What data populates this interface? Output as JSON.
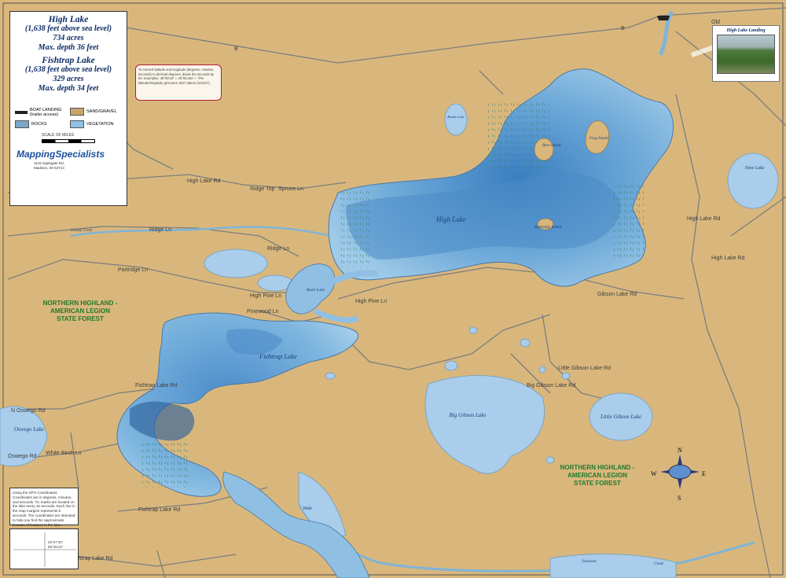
{
  "legend": {
    "high_name": "High Lake",
    "high_elev": "(1,638 feet above sea level)",
    "high_acres": "734 acres",
    "high_depth": "Max. depth 36 feet",
    "fish_name": "Fishtrap Lake",
    "fish_elev": "(1,638 feet above sea level)",
    "fish_acres": "329 acres",
    "fish_depth": "Max. depth 34 feet",
    "key_boat": "BOAT LANDING",
    "key_boat_sub": "(trailer access)",
    "key_sand": "SAND/GRAVEL",
    "key_rocks": "ROCKS",
    "key_veg": "VEGETATION",
    "scale": "SCALE OF MILES",
    "brand": "MappingSpecialists",
    "addr": [
      "1116 Applegate Rd.",
      "Madison, WI 53713"
    ]
  },
  "convert_box": "To convert latitude and longitude (degrees, minutes, seconds) to decimal degrees, divide the seconds by 60. Examples: 46°06'15\" = 46°06.250 — The latitude/longitude grid uses 1927 datum (NAD27).",
  "gps_box": "Using the GPS Coordinates. Coordinates are in degrees, minutes, and seconds. Tic marks are located on the lake every 15 seconds. Each line in the map margins represents 5 seconds. The coordinates are intended to help you find the approximate location of features in the lake.",
  "coord_box": {
    "lat": "46°07'40\"",
    "lon": "89°36'10\""
  },
  "landing_caption": "High Lake Landing",
  "lakes": {
    "high": "High Lake",
    "fishtrap": "Fishtrap Lake",
    "bear_island": "Bear Island",
    "frog_island": "Frog Island",
    "battleship_island": "Battleship Island",
    "rush": "Rush Lake",
    "oswego": "Oswego Lake",
    "big_gibson": "Big Gibson Lake",
    "little_gibson": "Little Gibson Lake",
    "sime": "Sime Lake",
    "hands": "Hands Lake",
    "wide": "Wide",
    "johnson": "Johnson",
    "grassy_creek": "Grassy Creek",
    "creek": "Creek"
  },
  "roads": {
    "b1": "B",
    "b2": "B",
    "high_lake_rd": "High Lake Rd",
    "ridge_top": "Ridge Top",
    "spruce": "Spruce Ln",
    "ridge_ln": "Ridge Ln",
    "ridge_ln2": "Ridge Ln",
    "partridge": "Partridge Ln",
    "high_pine": "High Pine Ln",
    "high_pine2": "High Pine Ln",
    "pinewood": "Pinewood Ln",
    "fishtrap_lake_rd": "Fishtrap Lake Rd",
    "n_oswego": "N Oswego Rd",
    "oswego_rd": "Oswego Rd",
    "white_birch": "White Birch Ln",
    "fishtrap_lake_rd2": "Fishtrap Lake Rd",
    "fishtrap_lake_rd3": "Fishtrap Lake Rd",
    "gibson_lake_rd": "Gibson Lake Rd",
    "big_gibson_rd": "Big Gibson Lake Rd",
    "little_gibson_rd": "Little Gibson Lake Rd",
    "high_lake_rd2": "High Lake Rd",
    "old": "Old",
    "high_lake_rd3": "High Lake Rd"
  },
  "forest": {
    "f1": [
      "NORTHERN HIGHLAND -",
      "AMERICAN LEGION",
      "STATE FOREST"
    ],
    "f2": [
      "NORTHERN HIGHLAND -",
      "AMERICAN LEGION",
      "STATE FOREST"
    ]
  },
  "compass": {
    "n": "N",
    "s": "S",
    "e": "E",
    "w": "W"
  },
  "colors": {
    "land": "#d9b77c",
    "water_deep": "#2f6fb0",
    "water_shallow": "#a9d0ea",
    "road": "#7a7a7a",
    "forest_label": "#1f7a2b"
  }
}
